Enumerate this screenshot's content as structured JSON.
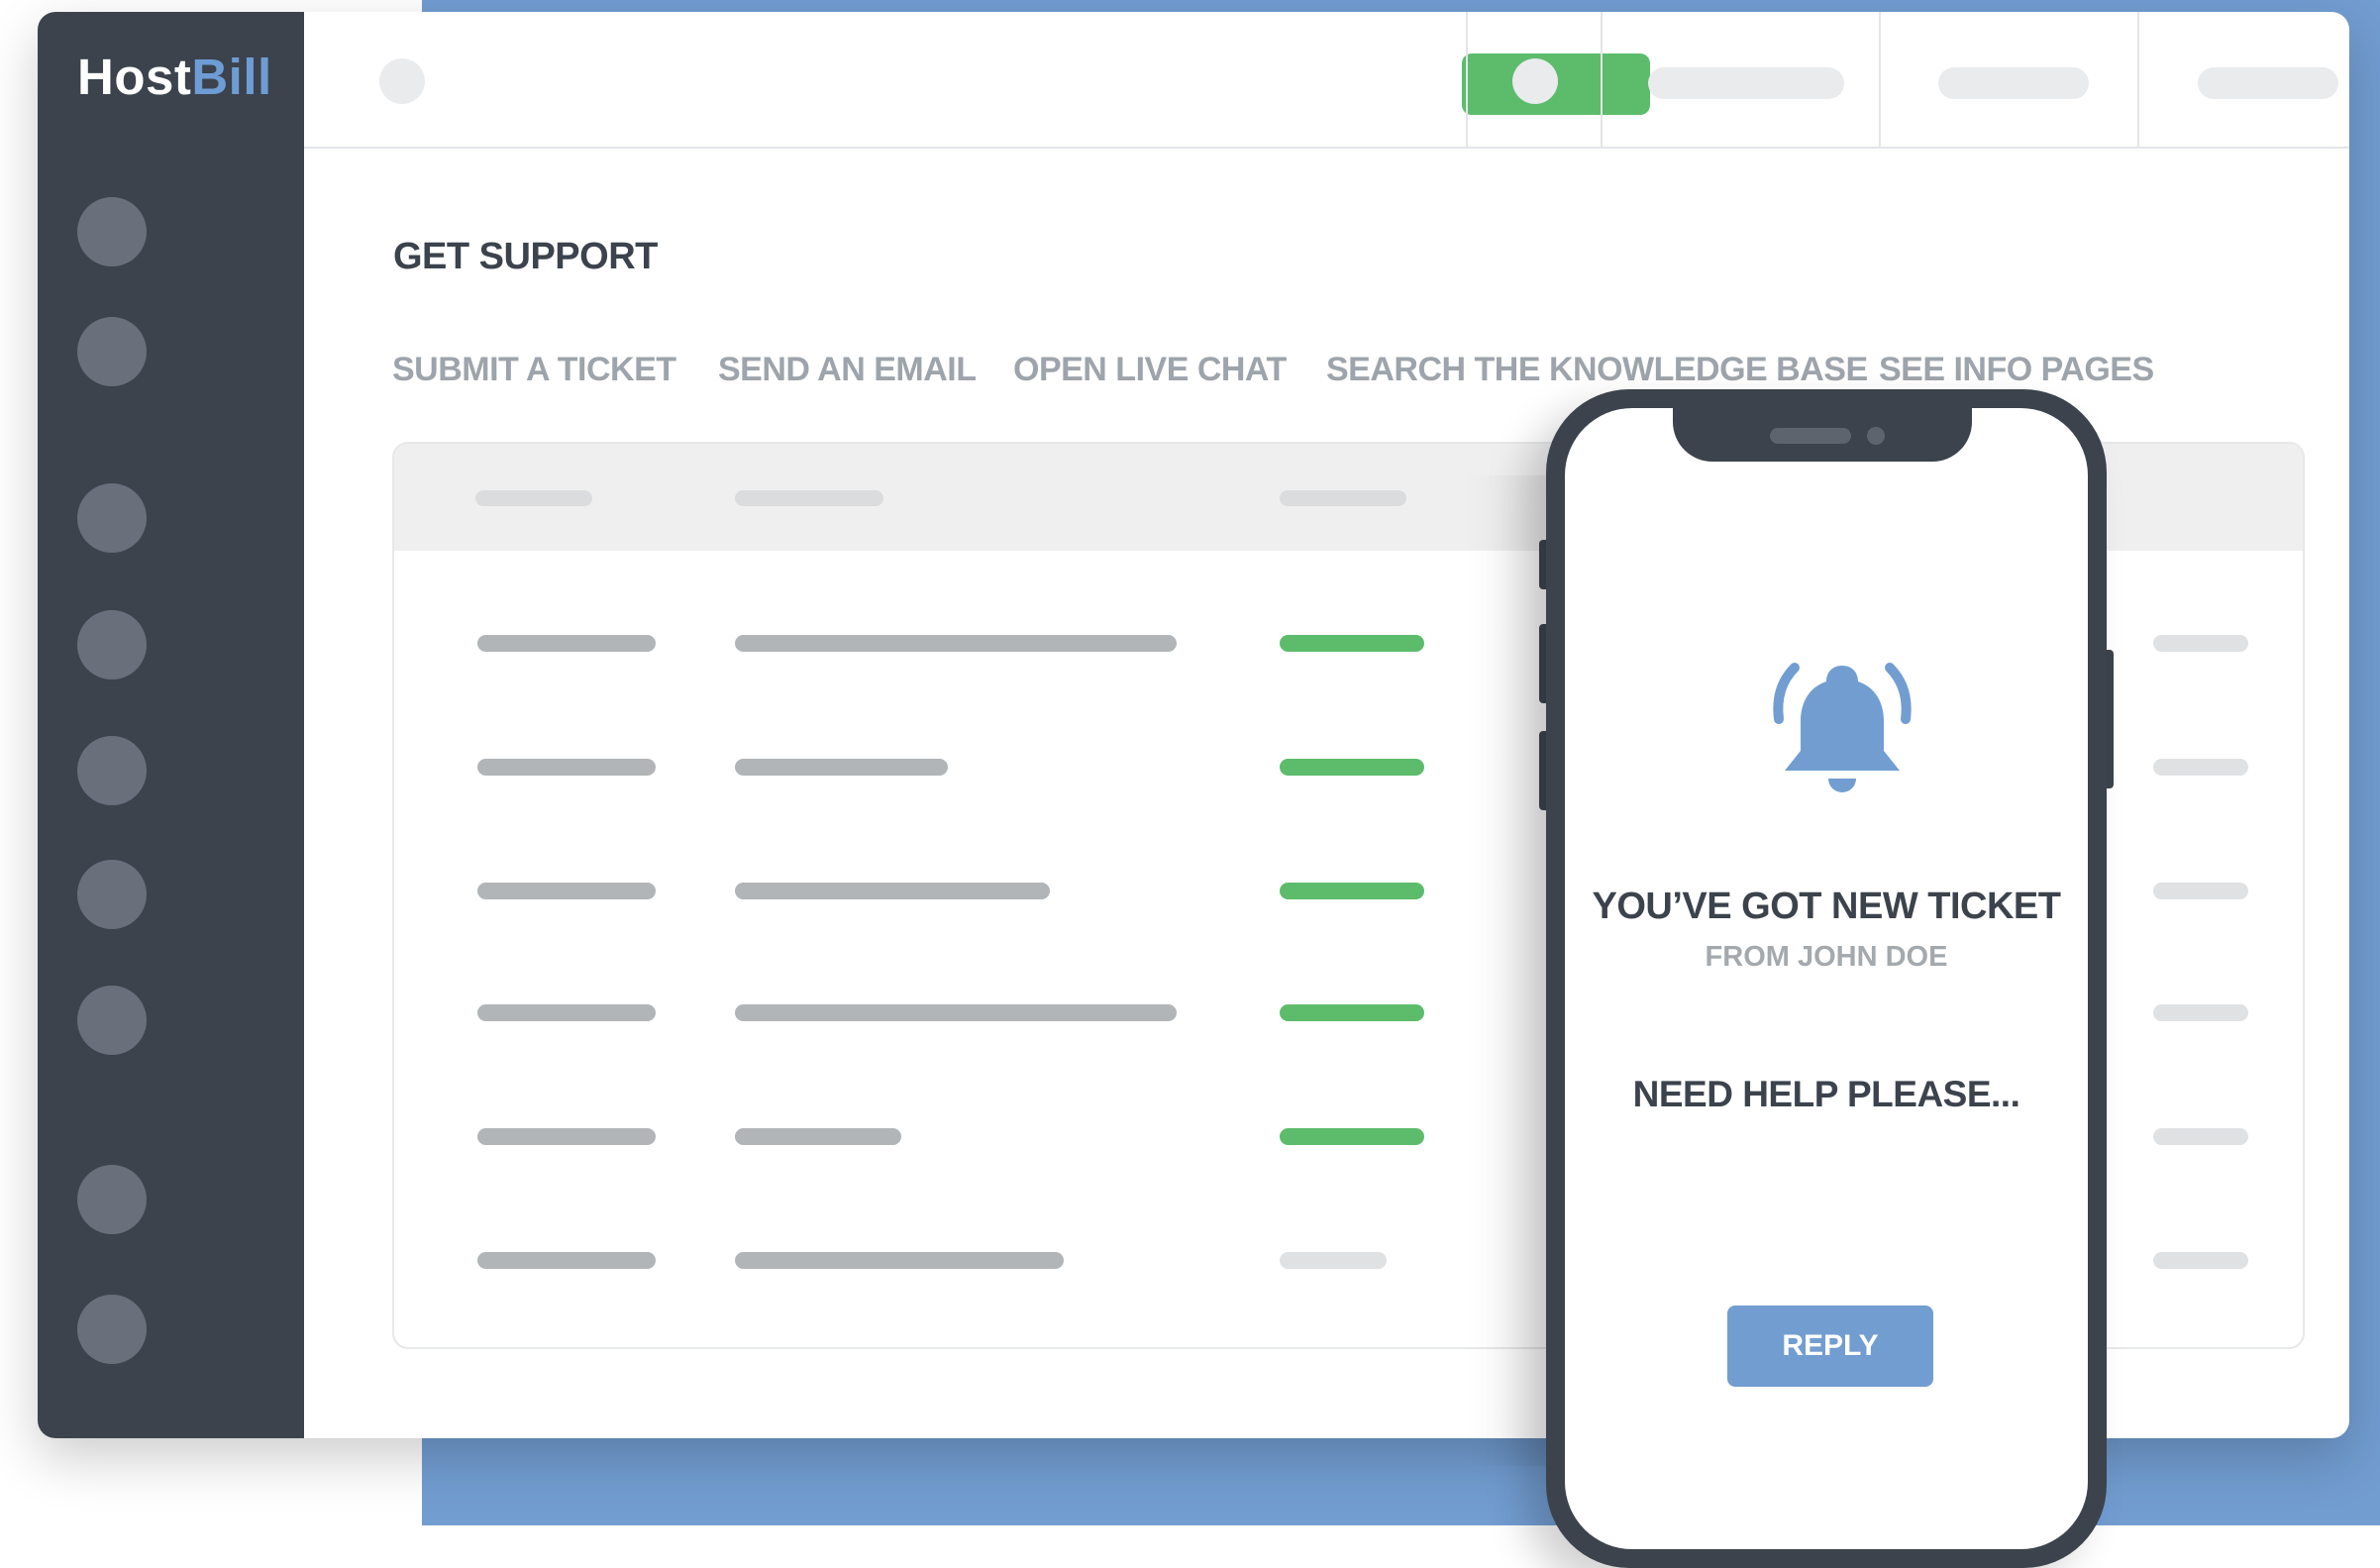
{
  "app": {
    "logo_left": "Host",
    "logo_right": "Bill"
  },
  "colors": {
    "sidebar": "#3c434c",
    "accent_blue": "#729dd1",
    "status_green": "#5cbc6b"
  },
  "sidebar": {
    "item_count": 9
  },
  "page": {
    "title": "GET SUPPORT"
  },
  "support_links": [
    "SUBMIT A TICKET",
    "SEND AN EMAIL",
    "OPEN LIVE CHAT",
    "SEARCH THE KNOWLEDGE BASE",
    "SEE INFO PAGES"
  ],
  "tickets_table": {
    "row_count": 6
  },
  "notification": {
    "icon": "bell-icon",
    "title": "YOU’VE GOT NEW TICKET",
    "from": "FROM JOHN DOE",
    "message": "NEED HELP PLEASE...",
    "reply_label": "REPLY"
  }
}
